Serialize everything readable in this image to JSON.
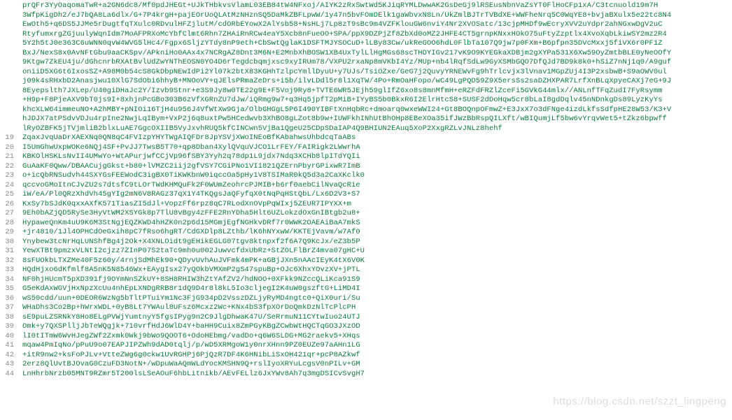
{
  "watermark": "https://blog.csdn.net/szzt_lingpeng",
  "top_block": [
    "prQFr3YyOaqomaTwR+a2GN6dc8/Mf0pdJHEGt+UJkTHbkvsVlamL03EB84tW4NFxoj/AIYK2zRxSwtWd5KJiqRYMLDwwAK2GsDeGj9lRSEusNbnVaZsYT0FlHoCFp1xA/C3tcnuold19m7H",
    "3WfpKigDh2/eJ7bQA8La6dlx/G+7P4krgH+pajEOrUoQLAtMzNHznSQ5DaMkZBFLpwW/1y47n5bvFOmDElk1gaWbvxN8Ln/UkZmlBJTrTVBdXE+WWFheNrq5C0WqYE8+bvjaBXulx5e22tc8N4",
    "EwOth5+q6DS5JJMe5rDugtfqTXulc0RDvulHFZjlutM/cdORbEYowX2AlYsb58+NsHLj7Lp8zT9sBc9m4VZFKlouGW6nviY4Nr2XVOSatc/13cjpMHDf9wEcryXVV2uYdpr2ahNGxwDgV2uC",
    "RtyfumxrgZGjuulyWqnIdm7MoAFPRXoMcYbfClmt6Rhn7ZHAiRnRCw4eaY5Xcb8nFueOO+SPA/ppX9DZPjZf8ZbXd0oMZ2JHFE4CT5grnpKNxxHOkO75uFtyZzptlx4XvoXqbLkiwSY2mz2R4",
    "5Y2h5tJ0e363C6uWNN0qvW4WVG5lHc4/Fgpx6SljzYTdy8nP9eth+CbSwtQglaK1DSFTMJYSOCuD+lLBy83Cw/ukReGOO6hdL0FlbTa107Q9jw7p0FXm+B6pfpn35DVcMxxj5fiVX6r0PF1Z",
    "BxJ/NexS8x0AvNFtGbu9aaCKSpv/APkniHo0AAx4x7NCRgAZ8Dnt3M6N+E2MnbXhBOSW1XB4UxTylLlHgMGs68scTHDYIGv217vK9O9KYEGkaXDBjm2gXYPa531X6Xw59OyZmtbBLE0yNeOOfY",
    "9Ktgw7ZkEU4ju/dGhcnrbRXAtBvlUdZwYNThEOSN0YO4D6rTegdcbqmjxsc9xyIRUm78/VXPU2rxaNp8mVKbI4Yz/MUp+nb4lRqfSdLw9GyXSMbGQO7DfQJd7BD9k8k0+hSiZ7nNj1q0/A9guf",
    "oniiD5XG6t6IxosSZ+A98M0b54cS8GkDbpNEwIdPi2Yl07k2btX83KGHhTzlpcYmllDyuU+y7UJs/TsiOZxe/GeG7j2QuvyYRNEWvFg9hTrlcvjx3lVnav1MGpZUj4I3P2xsbwB+S9aOWV0ul",
    "j09k4sRHxbD2Anasjwu10XlG7SdObi6hhyB+MNOoVY+qJElsPRmaZeDrs+i5b/ilvLDdl5r8l1XqTW/4Po+RmOaHFopo/wC49LgPQD59Z9X5ersSs2saDZHXPAR7LrfXnBLqXpyeCAXj7eG+9J",
    "8Eyepslth7JXLep/U40giDHaJc2Y/Izvb9Stnr+e3S9Jy8w0TE22g9E+F5Voj9Ry8+TVTE6WR5JEjh59glIfZ6xo8s8mnMfmH+eRZFdFRZlZceFi5GVkG44mlx//ANLnfTFqZudI7FyRsymm",
    "+H9p+F8PjeAXV9bT0js9I+8xhjnPcGBo303B6zVfXGRnZU7dJw/iQRmg9w7+q3Hq5jpfT2pMiB+IYyBS5b0BkxR6I2ElrHtcS8+SUSF2dDoHqw5cr8bLaI8gdDqlv45nNDnkgDs89LyzKyYs",
    "khcXLW64immeuNO+A2hMBY+pNIOi16TjH4u956J4VfWtXw9Gja/OlbGHGgL5P6I490YIBFtXnHqbRc+dmoarq0wxeWWI24+Gt8BOQnpOFmwZ+E3JxX7o3dFNge4izdLkfsSdfpHE28W53/K3+V",
    "hJDJX7atPSdvVDJu4rpIne2NwjLqIBym+VxP2j6q8uxtPw5HCedwvb3XhBO8gLZot8b9w+IUWFkhINhUtBhOHp8EBeXOa35ifJWzBbRspQILXft/wBIQumjLf5bw6vYrqvWet5+tZkz6bpwff",
    "lRyOZBFK5jTVjmliB2blxLuAE7GgcOXIIB5VyJxvhRUQ5kfCINCwn5VjBa1QgeU25CDpSDaIAP4Q9BHIUN2EAuq5XoP2XxgRZLvJNLz8hehf"
  ],
  "numbered_lines": [
    {
      "n": 19,
      "t": "ZqaxJvqUaDrXAEXNq0QN8qC4FVIzpYHYTWgAIQFDr8JpYSVjXWoINEoBfKAbahwsUhbdcqTaABs"
    },
    {
      "n": 20,
      "t": "I5UmGhwUxpWOKe6NQj4SF+PvJJ7TwsB5T70+qp8Dban4XylQVquVJCO1LrFEY/FAIRigk2LWwrhA"
    },
    {
      "n": 21,
      "t": "KBKOlHSKLsNvII4UMwYo+WtAPurjwfCCjVp96fSBY3Yyh2q78dp1L9jdx7Ndq3XCHb8lpITdYQIi"
    },
    {
      "n": 22,
      "t": "GuAaKF0Qww/DBAACujgGkst+b80+lVMZC2iij2gfVSY7CGiPNo1VI1821QZErnPbyrGPixwR7ImB"
    },
    {
      "n": 23,
      "t": "o+icQbRNSudvh44SXYGsFEEWodC3igBX0TiKWKbnW0iqccOa5pHy1V8TSIMaR0kQ5d3a2CaXKclk0"
    },
    {
      "n": 24,
      "t": "qccvoGMoItnCJvZU2s7dtsfC9tLOrTWdKHMQuFk2F0WUmZeohrcPJMIB+b6rf0aebCilNvaQcRie"
    },
    {
      "n": 25,
      "t": "iW/eA/Pl0QRzXhdVh45gYIg2mN6V8RAGz37qX1Y4TKQgsJaQFyfqX0tNqPqHStQbL/Lx6D2V3+S7"
    },
    {
      "n": 26,
      "t": "KxSy7bSJdK0qxxAXfK571TiasZI5dJl+VopzFf6rpz8qC7RLodXnOVpPqWIxj5ZEUR7IPYXX+m"
    },
    {
      "n": 27,
      "t": "9Eh0bAZjQD5RySe3HyVtWM2XSYGk8p7TlU8vBgy4zFFE2RnYDha5Hlt6UZLokzdOxGnIBtgb2u8+"
    },
    {
      "n": 28,
      "t": "HypaweQnKm4uU9K6M3StNgjEQZKWD4hHZK0n2p6d15MGmjEgfNGHkvDRf7r0WWK2OAEAiBaA7mkS"
    },
    {
      "n": 29,
      "t": "+jr4810/1Jl4OPHCdOeGxih8pC7fRso6hgRT/CdGXDlp8LZthb/lK6hNYxwW/KKTEjVavm/w7Af0"
    },
    {
      "n": 30,
      "t": "Ynybew3tcNrHqLUNShfBg4j2Ok+X4XNLOidt9gEHikEGLG07tgv8ktnpxf2f6A7Q9KcJx/eZ3b5P"
    },
    {
      "n": 31,
      "t": "YewXTBt9pmzxVLNtI2cjzz7ZInP07S2taTc9mh0u002JuwvcfdxUbRz+StZOLFlBrZ4mva07gHC+U"
    },
    {
      "n": 32,
      "t": "8sFUOkbLTXZMe40F5z60y/4rnjSdMhEk90+QDyvUvhAuJVFmk4mPK+aGBjJXn5nAAcIEyK4tX6V0K"
    },
    {
      "n": 33,
      "t": "HQdHjxo6dKfmlf8A5nK5N8546Wx+EAygIsx27yQOkbVMXmP2gS47spuBp+OJc6XhxYOvzXV+jPTL"
    },
    {
      "n": 34,
      "t": "NF0hjHUcmT5pXD391fj9OYmNnSZkUY+8SH8RHIW3hZtYAfZV2/hdNOO+0XFkk9NZccQLiKca91S9"
    },
    {
      "n": 35,
      "t": "G5eKdAxWGVjHxNpzXcUu4nhEpLXNDgRRB8r1dQ9D4r8l8kL5Io3cljegI2K4uW0gszftG+LiMD4I"
    },
    {
      "n": 36,
      "t": "wS50cdd/uun+0DEOR6WzNg5bTltPTuiYm1Nc3FjG934pD2VsszDZLjyRyMD4ngtc0+QiX0uri/Su"
    },
    {
      "n": 37,
      "t": "WHaDhs3Co2Bp+hWrxWDL+0yB8Lt7YWAul8UFsz6Mcxz2Wc+KNx4bS3fpXOrDoQmkDzNlTcPlcPH"
    },
    {
      "n": 38,
      "t": "sE9puLZSRNkY8Ho8ELgPVWjYumtnyY5fgsIPyg9n2C9JlgDhwaK47U/SeRrmuN11CYtwIuo24UTJ"
    },
    {
      "n": 39,
      "t": "Omk+y7QXSPlljJbTeWQgjk+710vrfHdJ6WlD4Y+baHH9Cuix8ZmPGyKBgZCwbWtHQCTqGO3JXzOD"
    },
    {
      "n": 40,
      "t": "lI0tITmW6WvHJegZWf2Zxmk0Wkj9bWo9QOOT6+OdoHEbmg/vadDo+q6W6SLDG+MG2raekv5+XHqs"
    },
    {
      "n": 41,
      "t": "mqaw4PmIqNo/pPuU9o07EAPJIPZWh9dAD0tqlj/p/wD5XRMgoW1y0nrXHnn9PZ0EUZe97aAHn1LG"
    },
    {
      "n": 42,
      "t": "+itR9nw2+ksFoPJLv+VtteZWg6g0ckw1UvRGHPj6PjQzR7DF4K6HNibLiSxOH421qr+pcP8AZkwf"
    },
    {
      "n": 43,
      "t": "2erz8QlUvtBJOvaG0CzuFD3NotN+/wDpuWaAQmWLdYocKMSHN9Q+rslIyoXRYuLcgsV0nPILv+GM"
    },
    {
      "n": 44,
      "t": "LnHhrbNrzb05MNT9RZmr5T200lsLSeAOuF6hbLitnikb/AEvFELlz6JxYWv8Ah7q3mgDSICvSvgH7"
    }
  ]
}
